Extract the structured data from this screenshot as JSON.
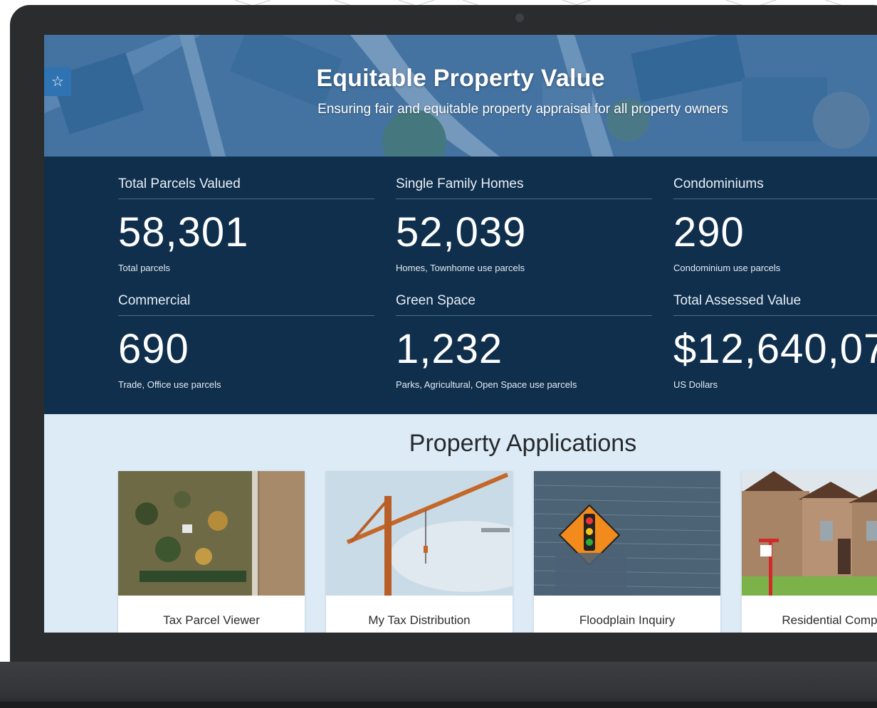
{
  "hero": {
    "title": "Equitable Property Value",
    "subtitle": "Ensuring fair and equitable property appraisal for all property owners",
    "bookmark_icon": "star-icon"
  },
  "stats": [
    {
      "label": "Total Parcels Valued",
      "value": "58,301",
      "note": "Total parcels"
    },
    {
      "label": "Single Family Homes",
      "value": "52,039",
      "note": "Homes, Townhome use parcels"
    },
    {
      "label": "Condominiums",
      "value": "290",
      "note": "Condominium use parcels"
    },
    {
      "label": "Commercial",
      "value": "690",
      "note": "Trade, Office use parcels"
    },
    {
      "label": "Green Space",
      "value": "1,232",
      "note": "Parks, Agricultural, Open Space use parcels"
    },
    {
      "label": "Total Assessed Value",
      "value": "$12,640,07",
      "note": "US Dollars"
    }
  ],
  "apps": {
    "title": "Property Applications",
    "cards": [
      {
        "label": "Tax Parcel Viewer"
      },
      {
        "label": "My Tax Distribution"
      },
      {
        "label": "Floodplain Inquiry"
      },
      {
        "label": "Residential Comp F"
      }
    ]
  },
  "colors": {
    "stats_bg": "#0f2f4d",
    "hero_accent": "#2f73b3",
    "apps_bg": "#dcebf6"
  }
}
